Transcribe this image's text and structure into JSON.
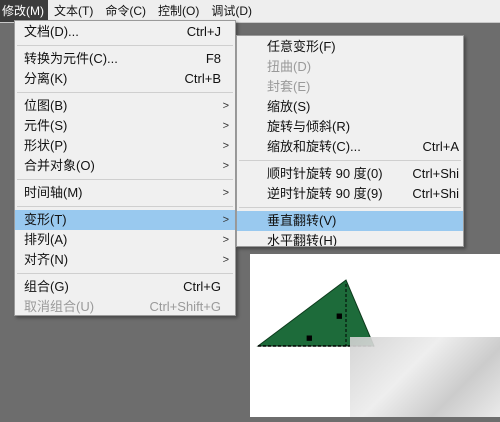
{
  "menubar": {
    "items": [
      {
        "label": "修改(M)",
        "active": true
      },
      {
        "label": "文本(T)"
      },
      {
        "label": "命令(C)"
      },
      {
        "label": "控制(O)"
      },
      {
        "label": "调试(D)"
      }
    ]
  },
  "modify_menu": {
    "document": {
      "label": "文档(D)...",
      "shortcut": "Ctrl+J"
    },
    "convert_to_symbol": {
      "label": "转换为元件(C)...",
      "shortcut": "F8"
    },
    "break_apart": {
      "label": "分离(K)",
      "shortcut": "Ctrl+B"
    },
    "bitmap": {
      "label": "位图(B)"
    },
    "symbol": {
      "label": "元件(S)"
    },
    "shape": {
      "label": "形状(P)"
    },
    "combine_objects": {
      "label": "合并对象(O)"
    },
    "timeline": {
      "label": "时间轴(M)"
    },
    "transform": {
      "label": "变形(T)"
    },
    "arrange": {
      "label": "排列(A)"
    },
    "align": {
      "label": "对齐(N)"
    },
    "group": {
      "label": "组合(G)",
      "shortcut": "Ctrl+G"
    },
    "ungroup": {
      "label": "取消组合(U)",
      "shortcut": "Ctrl+Shift+G"
    }
  },
  "transform_menu": {
    "free_transform": {
      "label": "任意变形(F)"
    },
    "distort": {
      "label": "扭曲(D)"
    },
    "envelope": {
      "label": "封套(E)"
    },
    "scale": {
      "label": "缩放(S)"
    },
    "rotate_skew": {
      "label": "旋转与倾斜(R)"
    },
    "scale_rotate": {
      "label": "缩放和旋转(C)...",
      "shortcut": "Ctrl+A"
    },
    "rotate_cw": {
      "label": "顺时针旋转 90 度(0)",
      "shortcut": "Ctrl+Shi"
    },
    "rotate_ccw": {
      "label": "逆时针旋转 90 度(9)",
      "shortcut": "Ctrl+Shi"
    },
    "flip_vertical": {
      "label": "垂直翻转(V)"
    },
    "flip_horizontal": {
      "label": "水平翻转(H)"
    }
  },
  "colors": {
    "highlight": "#99c9ef",
    "triangle_fill": "#1d6b3a",
    "menubar_active": "#3c3c3c"
  }
}
